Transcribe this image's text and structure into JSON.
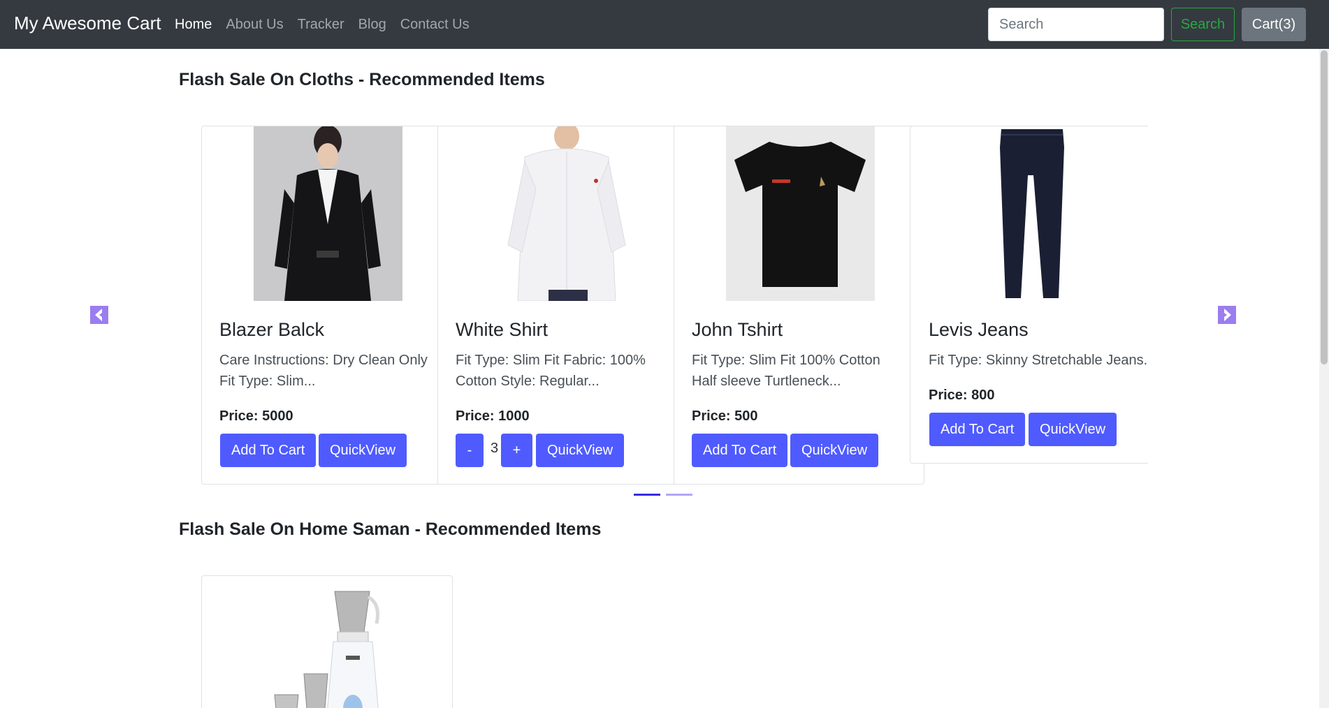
{
  "navbar": {
    "brand": "My Awesome Cart",
    "links": [
      "Home",
      "About Us",
      "Tracker",
      "Blog",
      "Contact Us"
    ],
    "search_placeholder": "Search",
    "search_button": "Search",
    "cart_button": "Cart(3)"
  },
  "section1": {
    "title": "Flash Sale On Cloths - Recommended Items",
    "products": [
      {
        "name": "Blazer Balck",
        "desc": "Care Instructions: Dry Clean Only Fit Type: Slim...",
        "price": "Price: 5000",
        "add_label": "Add To Cart",
        "quick_label": "QuickView"
      },
      {
        "name": "White Shirt",
        "desc": "Fit Type: Slim Fit Fabric: 100% Cotton Style: Regular...",
        "price": "Price: 1000",
        "minus": "-",
        "qty": "3",
        "plus": "+",
        "quick_label": "QuickView"
      },
      {
        "name": "John Tshirt",
        "desc": "Fit Type: Slim Fit 100% Cotton Half sleeve Turtleneck...",
        "price": "Price: 500",
        "add_label": "Add To Cart",
        "quick_label": "QuickView"
      },
      {
        "name": "Levis Jeans",
        "desc": "Fit Type: Skinny Stretchable Jeans...",
        "price": "Price: 800",
        "add_label": "Add To Cart",
        "quick_label": "QuickView"
      }
    ]
  },
  "section2": {
    "title": "Flash Sale On Home Saman - Recommended Items"
  },
  "colors": {
    "navbar_bg": "#343a40",
    "primary_button": "#4f5bff",
    "search_button": "#28a745",
    "cart_button": "#6c757d",
    "carousel_control": "#9b7df0"
  },
  "icons": {
    "prev": "chevron-left-icon",
    "next": "chevron-right-icon"
  }
}
